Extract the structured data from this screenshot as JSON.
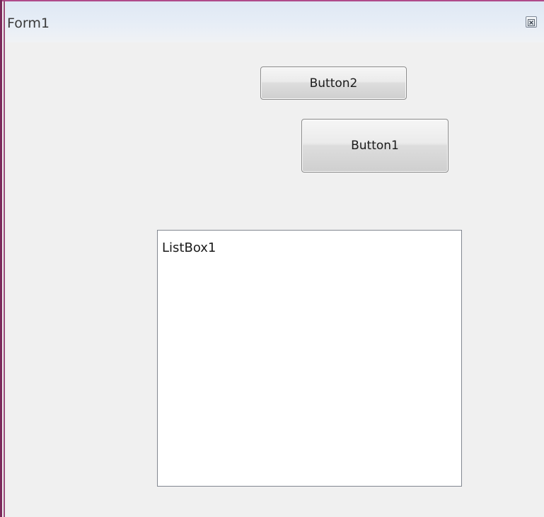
{
  "window": {
    "title": "Form1"
  },
  "buttons": {
    "button2_label": "Button2",
    "button1_label": "Button1"
  },
  "listbox": {
    "items": [
      "ListBox1"
    ]
  },
  "colors": {
    "frame_accent": "#b04a8a",
    "client_background": "#f0f0f0",
    "listbox_background": "#ffffff"
  },
  "icons": {
    "close": "close-icon"
  }
}
